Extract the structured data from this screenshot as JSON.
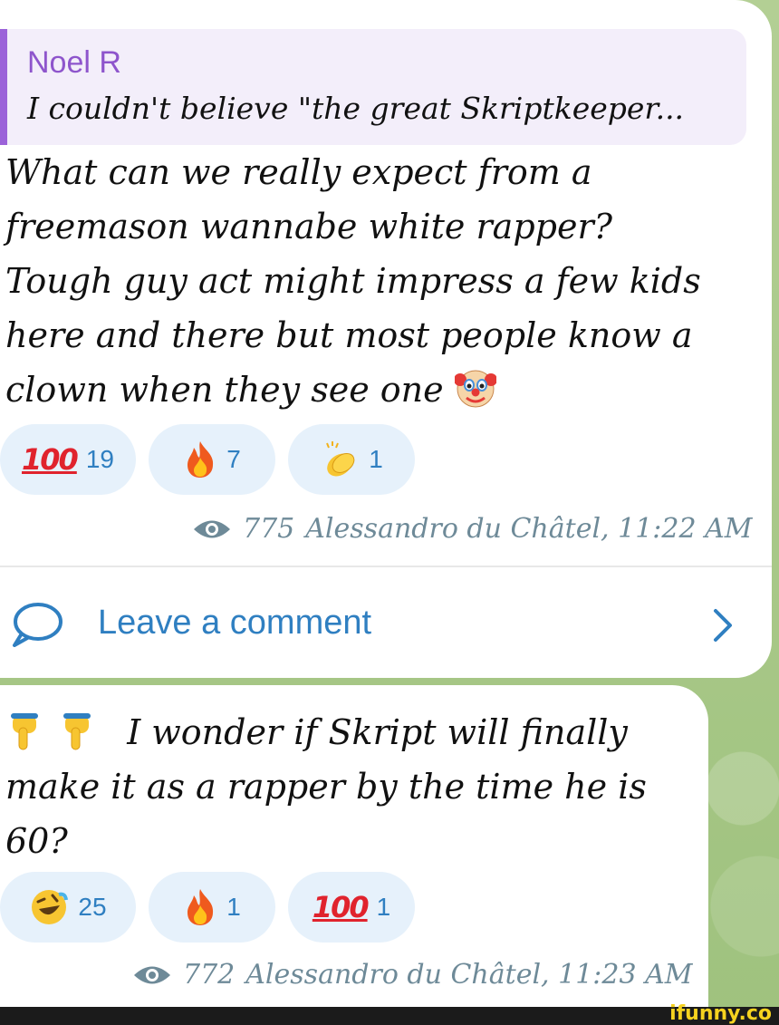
{
  "post": {
    "quote_author": "Noel R",
    "quote_text": "I couldn't believe \"the great Skriptkeeper...",
    "lines": [
      "What can we really expect from a",
      "freemason wannabe white rapper?",
      "Tough guy act might impress a few kids",
      "here and there but most people know a",
      "clown when they see one"
    ],
    "inline_emoji": "clown-face",
    "reactions": [
      {
        "emoji": "hundred-points",
        "label": "100",
        "count": "19"
      },
      {
        "emoji": "fire",
        "count": "7"
      },
      {
        "emoji": "clapping-hands",
        "count": "1"
      }
    ],
    "views": "775",
    "author_time": "Alessandro du Châtel, 11:22 AM",
    "comment_label": "Leave a comment"
  },
  "post2": {
    "lines": [
      "I wonder if Skript will finally",
      "make it as a rapper by the time he is",
      "60?"
    ],
    "lead_emoji": [
      "pointing-down-hand",
      "pointing-down-hand"
    ],
    "reactions": [
      {
        "emoji": "rolling-on-floor-laughing",
        "count": "25"
      },
      {
        "emoji": "fire",
        "count": "1"
      },
      {
        "emoji": "hundred-points",
        "label": "100",
        "count": "1"
      }
    ],
    "views": "772",
    "author_time": "Alessandro du Châtel, 11:23 AM"
  },
  "watermark": "ifunny.co",
  "colors": {
    "accent": "#2f7fc1",
    "quote_bar": "#9b62d9",
    "quote_bg": "#f3eefa",
    "reaction_bg": "#e6f1fb",
    "meta": "#6e8a98"
  }
}
